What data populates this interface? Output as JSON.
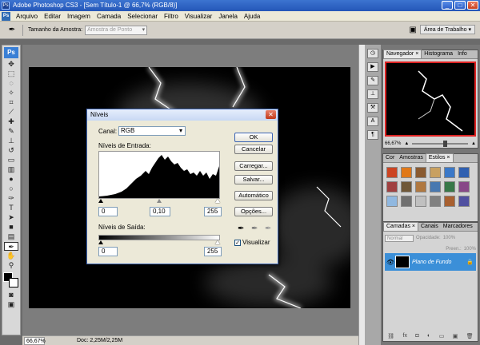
{
  "window": {
    "title": "Adobe Photoshop CS3 - [Sem Título-1 @ 66,7% (RGB/8)]",
    "minimize": "_",
    "maximize": "□",
    "close": "✕"
  },
  "menu": {
    "logo": "Ps",
    "items": [
      "Arquivo",
      "Editar",
      "Imagem",
      "Camada",
      "Selecionar",
      "Filtro",
      "Visualizar",
      "Janela",
      "Ajuda"
    ]
  },
  "options": {
    "sample_label": "Tamanho da Amostra:",
    "sample_value": "Amostra de Ponto",
    "workspace": "Área de Trabalho ▾"
  },
  "toolbox": {
    "logo": "Ps"
  },
  "status": {
    "zoom": "66,67%",
    "doc": "Doc: 2,25M/2,25M"
  },
  "panels": {
    "navigator": {
      "tabs": [
        "Navegador ×",
        "Histograma",
        "Info"
      ],
      "zoom": "66,67%"
    },
    "styles": {
      "tabs": [
        "Cor",
        "Amostras",
        "Estilos ×"
      ],
      "swatches": [
        "#cc4422",
        "#e07818",
        "#8a5a30",
        "#c8a060",
        "#3a78c8",
        "#3060b0",
        "#a04040",
        "#705838",
        "#b07840",
        "#4878b0",
        "#387848",
        "#884888",
        "#90b8e0",
        "#707070",
        "#c0c0c0",
        "#808080",
        "#a86030",
        "#5050a0"
      ]
    },
    "layers": {
      "tabs": [
        "Camadas ×",
        "Canais",
        "Marcadores"
      ],
      "mode": "Normal",
      "opacity_label": "Opacidade:",
      "opacity": "100%",
      "fill_label": "Preen.:",
      "fill": "100%",
      "layer_name": "Plano de Fundo"
    }
  },
  "dialog": {
    "title": "Níveis",
    "channel_label": "Canal:",
    "channel_value": "RGB",
    "input_label": "Níveis de Entrada:",
    "input_black": "0",
    "input_gamma": "0,10",
    "input_white": "255",
    "output_label": "Níveis de Saída:",
    "output_black": "0",
    "output_white": "255",
    "buttons": {
      "ok": "OK",
      "cancel": "Cancelar",
      "load": "Carregar...",
      "save": "Salvar...",
      "auto": "Automático",
      "options": "Opções..."
    },
    "preview_label": "Visualizar",
    "preview_checked": true
  }
}
